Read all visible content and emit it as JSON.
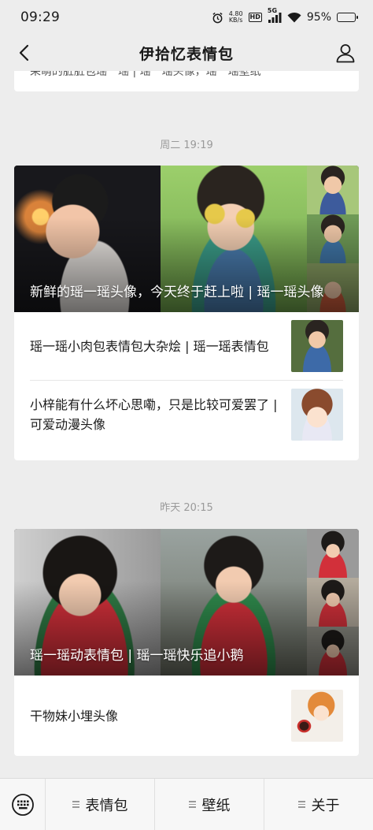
{
  "status_bar": {
    "time": "09:29",
    "net_speed_value": "4.80",
    "net_speed_unit": "KB/s",
    "hd_label": "HD",
    "signal_label": "5G",
    "battery_percent": "95%",
    "battery_level": 0.95
  },
  "nav": {
    "title": "伊拾忆表情包",
    "back_icon": "chevron-left-icon",
    "profile_icon": "person-icon"
  },
  "top_card": {
    "cut_text": "呆萌的脏脏包瑶一瑶 | 瑶一瑶头像，瑶一瑶壁纸"
  },
  "groups": [
    {
      "timestamp": "周二 19:19",
      "cover_title": "新鲜的瑶一瑶头像，今天终于赶上啦 | 瑶一瑶头像",
      "articles": [
        {
          "title": "瑶一瑶小肉包表情包大杂烩 | 瑶一瑶表情包"
        },
        {
          "title": "小梓能有什么坏心思嘞，只是比较可爱罢了 | 可爱动漫头像"
        }
      ]
    },
    {
      "timestamp": "昨天 20:15",
      "cover_title": "瑶一瑶动表情包 | 瑶一瑶快乐追小鹅",
      "articles": [
        {
          "title": "干物妹小埋头像"
        }
      ]
    }
  ],
  "tabbar": {
    "keyboard_icon": "keyboard-icon",
    "tabs": [
      {
        "label": "表情包"
      },
      {
        "label": "壁纸"
      },
      {
        "label": "关于"
      }
    ]
  },
  "colors": {
    "background": "#ededed",
    "card": "#ffffff",
    "timestamp": "#9a9a9a",
    "tabbar": "#f7f7f7"
  }
}
